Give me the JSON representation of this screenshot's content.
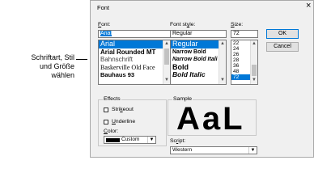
{
  "callout": {
    "line1": "Schriftart, Stil",
    "line2": "und Größe",
    "line3": "wählen"
  },
  "dialog": {
    "title": "Font",
    "close": "×",
    "font": {
      "label_pre": "",
      "label_acc": "F",
      "label_post": "ont:",
      "value": "Arial",
      "items": [
        "Arial",
        "Arial Rounded MT",
        "Bahnschrift",
        "Baskerville Old Face",
        "Bauhaus 93"
      ]
    },
    "style": {
      "label_pre": "Font st",
      "label_acc": "y",
      "label_post": "le:",
      "value": "Regular",
      "items": [
        "Regular",
        "Narrow Bold",
        "Narrow Bold Itali",
        "Bold",
        "Bold Italic"
      ]
    },
    "size": {
      "label_pre": "",
      "label_acc": "S",
      "label_post": "ize:",
      "value": "72",
      "items": [
        "22",
        "24",
        "26",
        "28",
        "36",
        "48",
        "72"
      ]
    },
    "ok": "OK",
    "cancel": "Cancel",
    "effects": {
      "label": "Effects",
      "strikeout_pre": "Stri",
      "strikeout_acc": "k",
      "strikeout_post": "eout",
      "underline_pre": "",
      "underline_acc": "U",
      "underline_post": "nderline",
      "color_pre": "",
      "color_acc": "C",
      "color_post": "olor:",
      "color_value": "Custom",
      "color_swatch": "#000000"
    },
    "sample": {
      "label": "Sample",
      "text": "AaL"
    },
    "script": {
      "label_pre": "Sc",
      "label_acc": "r",
      "label_post": "ipt:",
      "value": "Western"
    }
  },
  "colors": {
    "selection": "#0078d7",
    "dialog_bg": "#f0f0f0"
  }
}
